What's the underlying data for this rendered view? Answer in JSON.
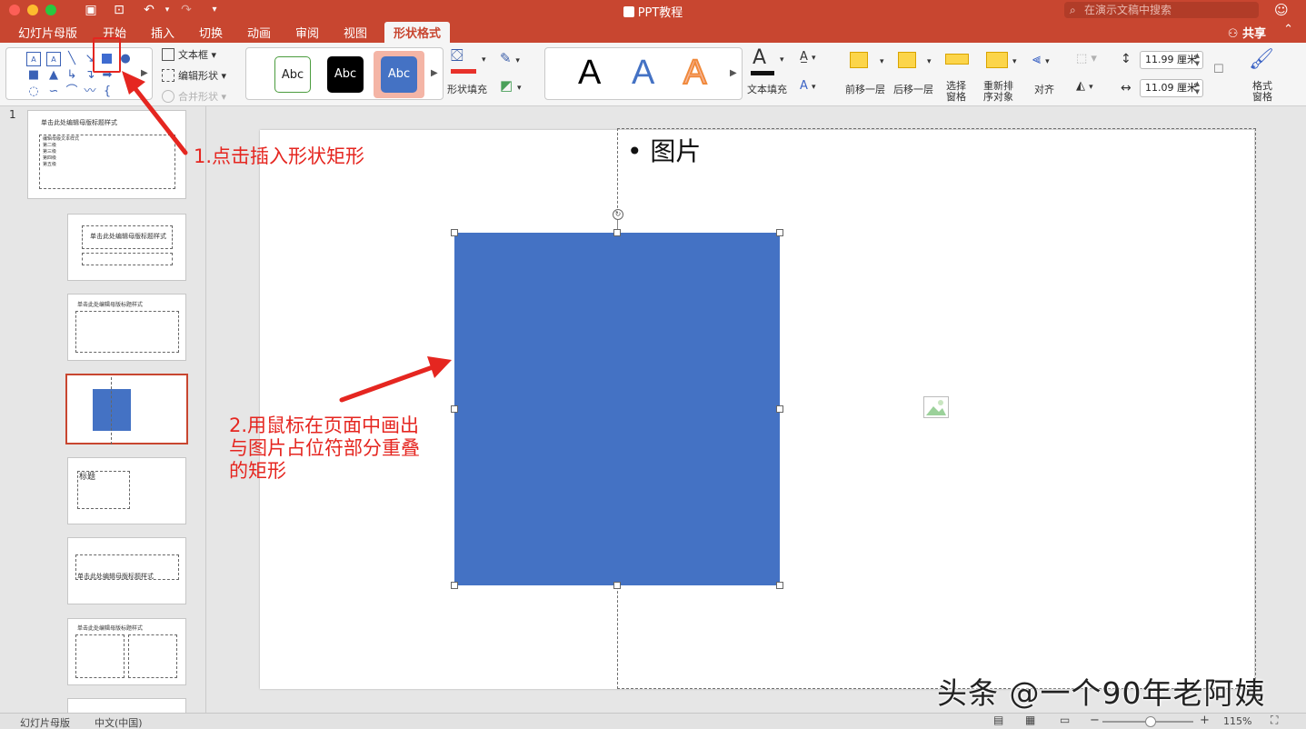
{
  "titlebar": {
    "title": "PPT教程",
    "search_placeholder": "在演示文稿中搜索"
  },
  "tabs": [
    {
      "label": "幻灯片母版"
    },
    {
      "label": "开始"
    },
    {
      "label": "插入"
    },
    {
      "label": "切换"
    },
    {
      "label": "动画"
    },
    {
      "label": "审阅"
    },
    {
      "label": "视图"
    },
    {
      "label": "形状格式",
      "active": true
    }
  ],
  "share_label": "共享",
  "ribbon": {
    "text_box": "文本框",
    "edit_shape": "编辑形状",
    "merge_shapes": "合并形状",
    "style_samples": [
      "Abc",
      "Abc",
      "Abc"
    ],
    "shape_fill": "形状填充",
    "wordart_samples": [
      "A",
      "A",
      "A"
    ],
    "text_fill": "文本填充",
    "bring_forward": "前移一层",
    "send_backward": "后移一层",
    "selection_pane": "选择\n窗格",
    "reorder_objects": "重新排\n序对象",
    "align": "对齐",
    "height_value": "11.99 厘米",
    "width_value": "11.09 厘米",
    "format_pane": "格式\n窗格"
  },
  "thumbnails": {
    "slide_number": "1",
    "master_title": "单击此处编辑母版标题样式",
    "master_body": [
      "编辑母版文本样式",
      "第二级",
      "第三级",
      "第四级",
      "第五级"
    ],
    "layout_title": "单击此处编辑母版标题样式",
    "title_word": "标题"
  },
  "slide": {
    "bullet_text": "图片"
  },
  "annotations": {
    "step1": "1.点击插入形状矩形",
    "step2_lines": [
      "2.用鼠标在页面中画出",
      "与图片占位符部分重叠",
      "的矩形"
    ]
  },
  "watermark": "头条 @一个90年老阿姨",
  "statusbar": {
    "view_name": "幻灯片母版",
    "language": "中文(中国)",
    "zoom": "115%"
  },
  "colors": {
    "accent": "#c84630",
    "shape_fill": "#4472c4",
    "annotation": "#e52620"
  }
}
